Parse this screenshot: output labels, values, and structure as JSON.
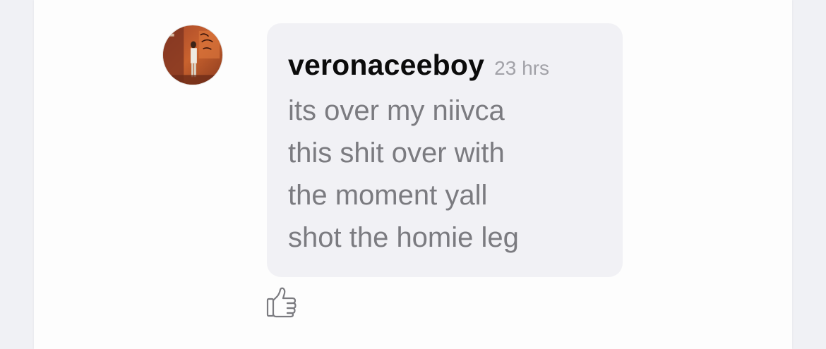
{
  "comment": {
    "username": "veronaceeboy",
    "timestamp": "23 hrs",
    "message_lines": [
      "its over my niivca",
      "this shit over with",
      "the moment yall",
      "shot the homie leg"
    ],
    "avatar": "user-avatar",
    "like_icon": "thumbs-up-icon"
  },
  "colors": {
    "page_background": "#f0f1f5",
    "panel_background": "#fdfdfd",
    "bubble_background": "#f1f1f5",
    "username": "#0b0b0b",
    "timestamp": "#a2a2a8",
    "message_text": "#7b7b80",
    "icon": "#7b7b80"
  }
}
